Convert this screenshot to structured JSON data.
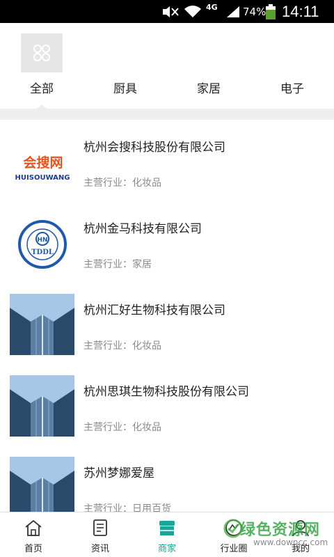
{
  "status_bar": {
    "network": "4G",
    "battery_percent": "74%",
    "time": "14:11"
  },
  "categories": {
    "tabs": [
      {
        "label": "全部",
        "selected": true
      },
      {
        "label": "厨具",
        "selected": false
      },
      {
        "label": "家居",
        "selected": false
      },
      {
        "label": "电子",
        "selected": false
      }
    ]
  },
  "companies": [
    {
      "name": "杭州会搜科技股份有限公司",
      "industry": "主营行业：化妆品",
      "logo": "huisouwang-logo",
      "logo_cn": "会搜网",
      "logo_en": "HUISOUWANG"
    },
    {
      "name": "杭州金马科技有限公司",
      "industry": "主营行业：家居",
      "logo": "tddl-seal-logo",
      "logo_text": "TDDL"
    },
    {
      "name": "杭州汇好生物科技有限公司",
      "industry": "主营行业：化妆品",
      "logo": "building-photo"
    },
    {
      "name": "杭州思琪生物科技股份有限公司",
      "industry": "主营行业：化妆品",
      "logo": "building-photo"
    },
    {
      "name": "苏州梦娜爱屋",
      "industry": "主营行业：日用百货",
      "logo": "building-photo"
    }
  ],
  "bottom_nav": [
    {
      "label": "首页",
      "icon": "home-icon",
      "active": false
    },
    {
      "label": "资讯",
      "icon": "news-icon",
      "active": false
    },
    {
      "label": "商家",
      "icon": "store-icon",
      "active": true
    },
    {
      "label": "行业圈",
      "icon": "circle-icon",
      "active": false
    },
    {
      "label": "我的",
      "icon": "user-icon",
      "active": false
    }
  ],
  "watermark": {
    "text": "绿色资源网",
    "url": "www.downcc.com"
  },
  "colors": {
    "accent": "#1aa59a",
    "divider": "#eeeeee",
    "secondary_text": "#8a8a8a"
  }
}
